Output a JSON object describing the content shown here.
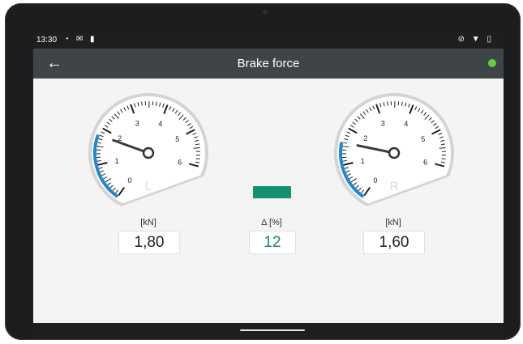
{
  "status_bar": {
    "time": "13:30",
    "left_icons": [
      "sync-icon",
      "mail-icon",
      "battery-charging-icon"
    ],
    "right_icons": [
      "mute-icon",
      "wifi-icon",
      "battery-icon"
    ]
  },
  "app_bar": {
    "title": "Brake force",
    "status_color": "#5fcf3b"
  },
  "left_gauge": {
    "label": "L",
    "tick_labels": [
      "0",
      "1",
      "2",
      "3",
      "4",
      "5",
      "6"
    ],
    "max": 6,
    "value": 1.8,
    "unit": "[kN]",
    "display_value": "1,80"
  },
  "right_gauge": {
    "label": "R",
    "tick_labels": [
      "0",
      "1",
      "2",
      "3",
      "4",
      "5",
      "6"
    ],
    "max": 6,
    "value": 1.6,
    "unit": "[kN]",
    "display_value": "1,60"
  },
  "delta": {
    "unit": "Δ [%]",
    "value": "12",
    "indicator_color": "#12936d"
  },
  "colors": {
    "arc": "#1e88d8",
    "needle": "#3a3a3a",
    "appbar": "#3e4447"
  }
}
